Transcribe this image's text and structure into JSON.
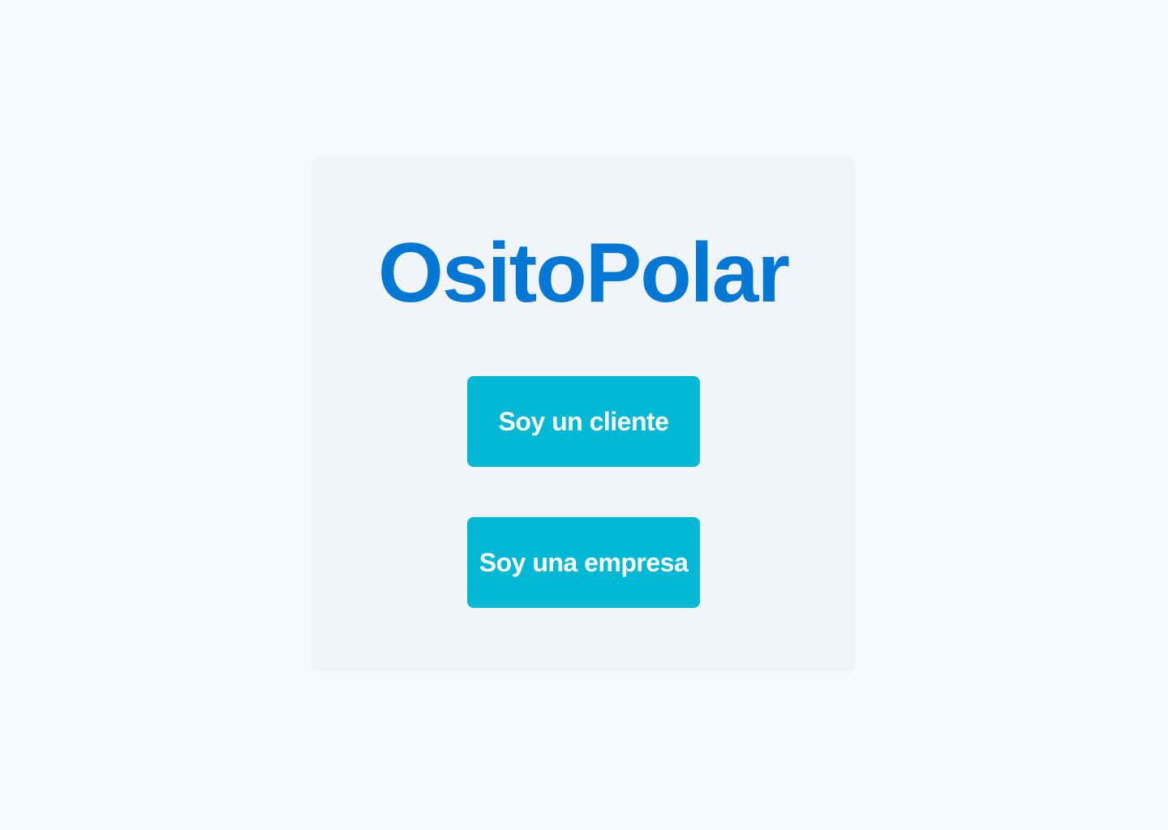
{
  "app": {
    "title": "OsitoPolar"
  },
  "actions": {
    "client_label": "Soy un cliente",
    "company_label": "Soy una empresa"
  },
  "colors": {
    "background": "#f5f9fe",
    "card": "#f1f5fa",
    "brand": "#0278d4",
    "button": "#00b8d4",
    "button_text": "#ffffff"
  }
}
